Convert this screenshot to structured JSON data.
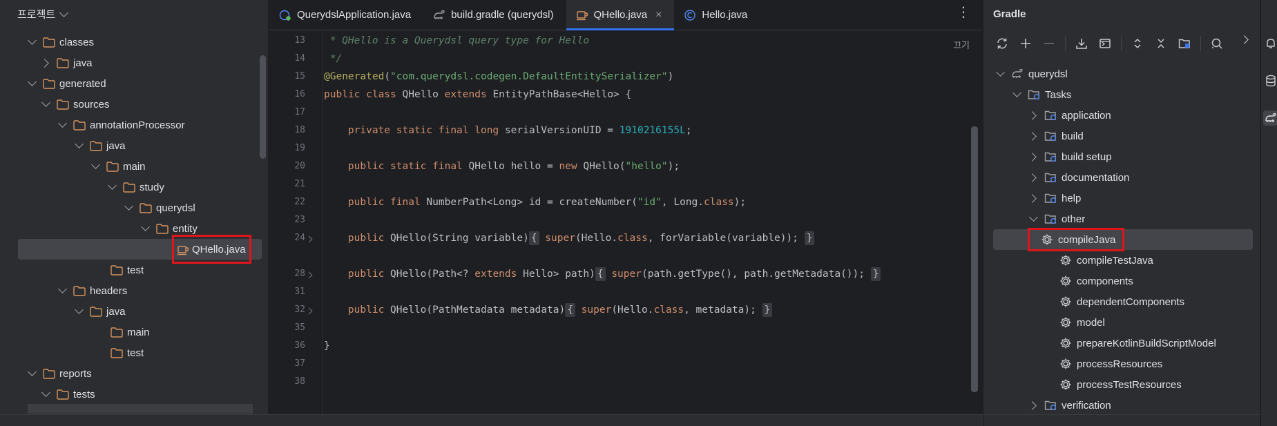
{
  "project": {
    "title": "프로젝트",
    "tree": [
      {
        "label": "classes",
        "expanded": true,
        "type": "folder"
      },
      {
        "label": "java",
        "expanded": false,
        "type": "folder"
      },
      {
        "label": "generated",
        "expanded": true,
        "type": "folder"
      },
      {
        "label": "sources",
        "expanded": true,
        "type": "folder"
      },
      {
        "label": "annotationProcessor",
        "expanded": true,
        "type": "folder"
      },
      {
        "label": "java",
        "expanded": true,
        "type": "folder"
      },
      {
        "label": "main",
        "expanded": true,
        "type": "folder"
      },
      {
        "label": "study",
        "expanded": true,
        "type": "folder"
      },
      {
        "label": "querydsl",
        "expanded": true,
        "type": "folder"
      },
      {
        "label": "entity",
        "expanded": true,
        "type": "folder"
      },
      {
        "label": "QHello.java",
        "type": "java-file",
        "selected": true
      },
      {
        "label": "test",
        "type": "folder"
      },
      {
        "label": "headers",
        "expanded": true,
        "type": "folder"
      },
      {
        "label": "java",
        "expanded": true,
        "type": "folder"
      },
      {
        "label": "main",
        "type": "folder"
      },
      {
        "label": "test",
        "type": "folder"
      },
      {
        "label": "reports",
        "expanded": true,
        "type": "folder"
      },
      {
        "label": "tests",
        "expanded": true,
        "type": "folder"
      }
    ]
  },
  "editor": {
    "tabs": [
      {
        "label": "QuerydslApplication.java",
        "icon": "spring-class-icon"
      },
      {
        "label": "build.gradle (querydsl)",
        "icon": "gradle-elephant-icon"
      },
      {
        "label": "QHello.java",
        "icon": "java-file-icon",
        "active": true,
        "close": "×"
      },
      {
        "label": "Hello.java",
        "icon": "class-icon"
      }
    ],
    "more_menu": "⋮",
    "reader_mode": "끄기",
    "line_numbers": [
      "13",
      "14",
      "15",
      "16",
      "17",
      "18",
      "19",
      "20",
      "21",
      "22",
      "23",
      "24",
      "28",
      "31",
      "32",
      "35",
      "36",
      "37",
      "38"
    ]
  },
  "gradle": {
    "title": "Gradle",
    "root": "querydsl",
    "tasks_label": "Tasks",
    "groups": [
      "application",
      "build",
      "build setup",
      "documentation",
      "help",
      "other"
    ],
    "other_tasks": [
      "compileJava",
      "compileTestJava",
      "components",
      "dependentComponents",
      "model",
      "prepareKotlinBuildScriptModel",
      "processResources",
      "processTestResources"
    ],
    "last_group": "verification",
    "selected_task": "compileJava",
    "toolbar": [
      "reload-icon",
      "add-icon",
      "remove-icon",
      "download-icon",
      "script-icon",
      "expand-all-icon",
      "collapse-all-icon",
      "link-project-icon",
      "analyze-icon"
    ]
  },
  "colors": {
    "accent": "#3574f0",
    "highlight_box": "#e0141b",
    "keyword": "#cf8e6d",
    "string": "#6aab73",
    "number": "#2aacb8",
    "doc_comment": "#5f826b"
  }
}
